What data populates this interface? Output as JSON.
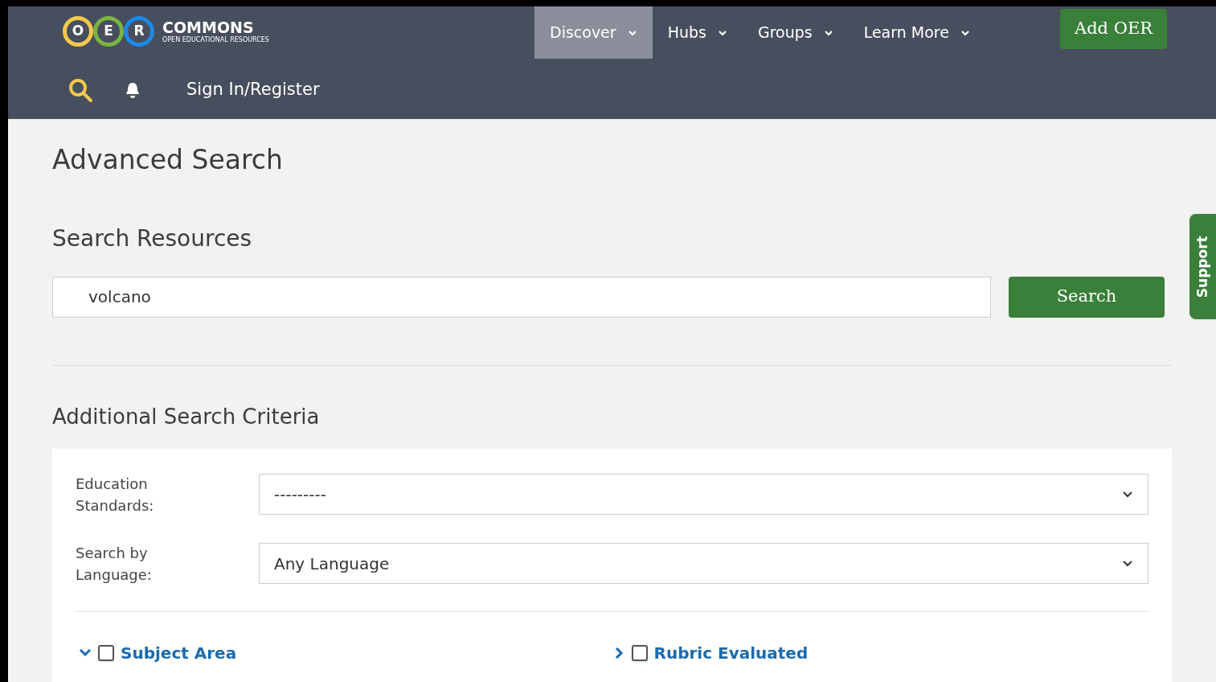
{
  "logo": {
    "letters": [
      {
        "text": "O",
        "color": "#f2c94c"
      },
      {
        "text": "E",
        "color": "#7cb342"
      },
      {
        "text": "R",
        "color": "#1e88e5"
      }
    ],
    "name": "COMMONS",
    "tagline": "OPEN EDUCATIONAL RESOURCES"
  },
  "nav": [
    {
      "label": "Discover",
      "selected": true
    },
    {
      "label": "Hubs",
      "selected": false
    },
    {
      "label": "Groups",
      "selected": false
    },
    {
      "label": "Learn More",
      "selected": false
    }
  ],
  "add_button": "Add OER",
  "sign_in": "Sign In/Register",
  "title": "Advanced Search",
  "section": "Search Resources",
  "search": {
    "value": "volcano",
    "button": "Search"
  },
  "criteria_title": "Additional Search Criteria",
  "selects": [
    {
      "label": "Education Standards:",
      "value": "---------"
    },
    {
      "label": "Search by Language:",
      "value": "Any Language"
    }
  ],
  "filters": [
    {
      "label": "Subject Area",
      "expanded": true,
      "checked": false
    },
    {
      "label": "Rubric Evaluated",
      "expanded": false,
      "checked": false
    }
  ],
  "support_tab": "Support"
}
